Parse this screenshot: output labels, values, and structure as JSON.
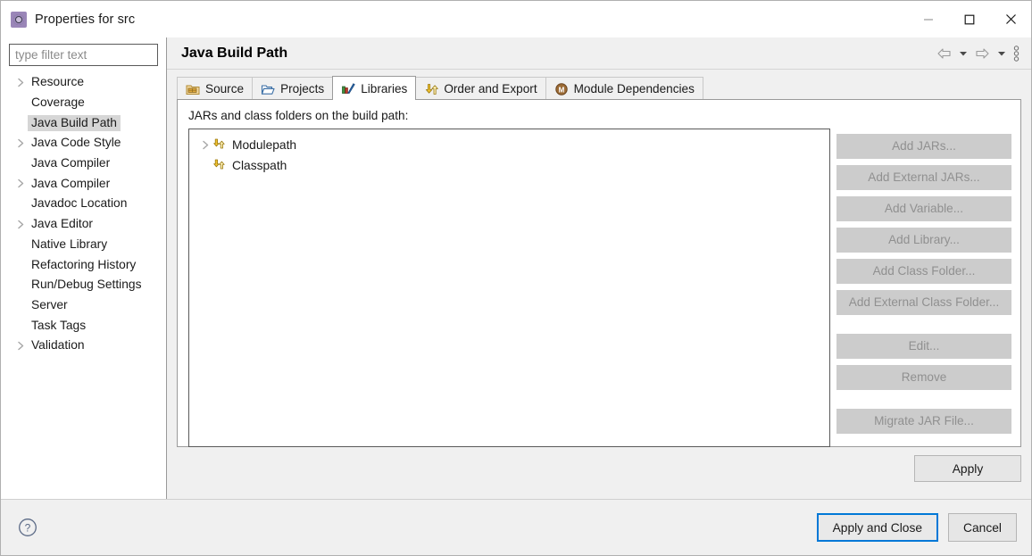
{
  "window": {
    "title": "Properties for src",
    "icon": "eclipse-properties-icon",
    "controls": {
      "minimize": "minimize-icon",
      "maximize": "maximize-icon",
      "close": "close-icon"
    }
  },
  "sidebar": {
    "filter": {
      "value": "",
      "placeholder": "type filter text"
    },
    "items": [
      {
        "label": "Resource",
        "expandable": true,
        "selected": false
      },
      {
        "label": "Coverage",
        "expandable": false,
        "selected": false
      },
      {
        "label": "Java Build Path",
        "expandable": false,
        "selected": true
      },
      {
        "label": "Java Code Style",
        "expandable": true,
        "selected": false
      },
      {
        "label": "Java Compiler",
        "expandable": false,
        "selected": false
      },
      {
        "label": "Java Compiler",
        "expandable": true,
        "selected": false
      },
      {
        "label": "Javadoc Location",
        "expandable": false,
        "selected": false
      },
      {
        "label": "Java Editor",
        "expandable": true,
        "selected": false
      },
      {
        "label": "Native Library",
        "expandable": false,
        "selected": false
      },
      {
        "label": "Refactoring History",
        "expandable": false,
        "selected": false
      },
      {
        "label": "Run/Debug Settings",
        "expandable": false,
        "selected": false
      },
      {
        "label": "Server",
        "expandable": false,
        "selected": false
      },
      {
        "label": "Task Tags",
        "expandable": false,
        "selected": false
      },
      {
        "label": "Validation",
        "expandable": true,
        "selected": false
      }
    ]
  },
  "page": {
    "title": "Java Build Path",
    "tools": [
      {
        "name": "back-arrow-icon"
      },
      {
        "name": "back-dropdown-icon"
      },
      {
        "name": "forward-arrow-icon"
      },
      {
        "name": "forward-dropdown-icon"
      },
      {
        "name": "view-menu-icon"
      }
    ]
  },
  "tabs": [
    {
      "label": "Source",
      "icon": "source-folder-icon",
      "active": false
    },
    {
      "label": "Projects",
      "icon": "projects-folder-icon",
      "active": false
    },
    {
      "label": "Libraries",
      "icon": "libraries-books-icon",
      "active": true
    },
    {
      "label": "Order and Export",
      "icon": "order-export-arrows-icon",
      "active": false
    },
    {
      "label": "Module Dependencies",
      "icon": "module-circle-icon",
      "active": false
    }
  ],
  "libraries": {
    "description": "JARs and class folders on the build path:",
    "tree": [
      {
        "label": "Modulepath",
        "expandable": true,
        "icon": "classpath-arrows-icon"
      },
      {
        "label": "Classpath",
        "expandable": false,
        "icon": "classpath-arrows-icon"
      }
    ],
    "buttons": [
      {
        "label": "Add JARs...",
        "enabled": false,
        "group": 1
      },
      {
        "label": "Add External JARs...",
        "enabled": false,
        "group": 1
      },
      {
        "label": "Add Variable...",
        "enabled": false,
        "group": 1
      },
      {
        "label": "Add Library...",
        "enabled": false,
        "group": 1
      },
      {
        "label": "Add Class Folder...",
        "enabled": false,
        "group": 1
      },
      {
        "label": "Add External Class Folder...",
        "enabled": false,
        "group": 1
      },
      {
        "label": "Edit...",
        "enabled": false,
        "group": 2
      },
      {
        "label": "Remove",
        "enabled": false,
        "group": 2
      },
      {
        "label": "Migrate JAR File...",
        "enabled": false,
        "group": 3
      }
    ]
  },
  "footer": {
    "apply_label": "Apply",
    "help_icon": "help-question-icon",
    "apply_and_close_label": "Apply and Close",
    "cancel_label": "Cancel"
  },
  "colors": {
    "focus_border": "#0078d7",
    "selection": "#d6d6d6",
    "panel_bg": "#f0f0f0",
    "disabled_button": "#cccccc",
    "disabled_text": "#909090"
  }
}
